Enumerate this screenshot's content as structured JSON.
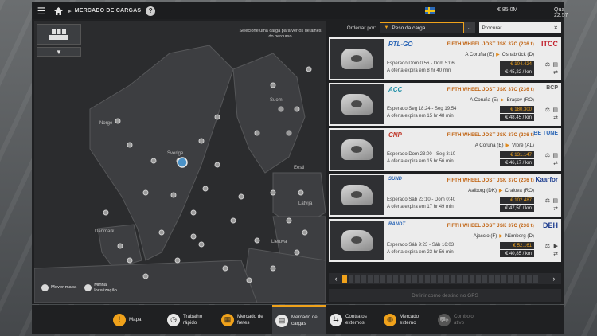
{
  "topbar": {
    "menu_icon": "hamburger-icon",
    "home_icon": "home-icon",
    "breadcrumb": "MERCADO DE CARGAS",
    "help": "?",
    "money": "€ 85,0M",
    "time": "Qua 22:57"
  },
  "map": {
    "hint": "Selecione uma carga para ver os detalhes do percurso",
    "labels": [
      "Norge",
      "Sverige",
      "Suomi",
      "Eesti",
      "Latvija",
      "Danmark",
      "Lietuva"
    ],
    "footer": {
      "move_label": "Mover mapa",
      "locate_label": "Minha localização"
    }
  },
  "sort": {
    "label": "Ordenar por:",
    "selected": "Peso da carga",
    "search_placeholder": "Procurar..."
  },
  "cargo": [
    {
      "company": "RTL-GO",
      "company2": "ITCC",
      "cargo": "FIFTH WHEEL JOST JSK 37C (236 t)",
      "from": "A Coruña (E)",
      "to": "Osnabrück (D)",
      "time1": "Esperado Dom 0:56 - Dom 5:06",
      "time2": "A oferta expira em 8 hr 40 min",
      "price": "€ 104.424",
      "perkm": "€ 45,22 / km"
    },
    {
      "company": "ACC",
      "company2": "BCP",
      "cargo": "FIFTH WHEEL JOST JSK 37C (236 t)",
      "from": "A Coruña (E)",
      "to": "Brașov (RO)",
      "time1": "Esperado Seg 18:24 - Seg 19:54",
      "time2": "A oferta expira em 15 hr 48 min",
      "price": "€ 180.300",
      "perkm": "€ 48,45 / km"
    },
    {
      "company": "CNP",
      "company2": "BE TUNE",
      "cargo": "FIFTH WHEEL JOST JSK 37C (236 t)",
      "from": "A Coruña (E)",
      "to": "Vlorë (AL)",
      "time1": "Esperado Dom 23:00 - Seg 3:10",
      "time2": "A oferta expira em 15 hr 56 min",
      "price": "€ 131.147",
      "perkm": "€ 46,17 / km"
    },
    {
      "company": "SUND",
      "company2": "Kaarfor",
      "cargo": "FIFTH WHEEL JOST JSK 37C (236 t)",
      "from": "Aalborg (DK)",
      "to": "Craiova (RO)",
      "time1": "Esperado Sáb 23:10 - Dom 0:40",
      "time2": "A oferta expira em 17 hr 49 min",
      "price": "€ 102.487",
      "perkm": "€ 47,50 / km"
    },
    {
      "company": "RANDT",
      "company2": "DEH",
      "cargo": "FIFTH WHEEL JOST JSK 37C (236 t)",
      "from": "Ajaccio (F)",
      "to": "Nürnberg (D)",
      "time1": "Esperado Sáb 9:23 - Sáb 16:03",
      "time2": "A oferta expira em 23 hr 56 min",
      "price": "€ 52.161",
      "perkm": "€ 40,85 / km"
    }
  ],
  "gps_button": "Definir como destino no GPS",
  "nav": [
    {
      "label": "Mapa",
      "icon": "map-icon",
      "color": "#f0a21b"
    },
    {
      "label": "Trabalho rápido",
      "icon": "clock-icon",
      "color": "#f0a21b"
    },
    {
      "label": "Mercado de fretes",
      "icon": "freight-icon",
      "color": "#f0a21b"
    },
    {
      "label": "Mercado de cargas",
      "icon": "cargo-icon",
      "color": "#f0a21b"
    },
    {
      "label": "Contratos externos",
      "icon": "contracts-icon",
      "color": "#f0a21b"
    },
    {
      "label": "Mercado externo",
      "icon": "globe-icon",
      "color": "#f0a21b"
    },
    {
      "label": "Comboio ativo",
      "icon": "convoy-icon",
      "color": "#777777"
    }
  ]
}
